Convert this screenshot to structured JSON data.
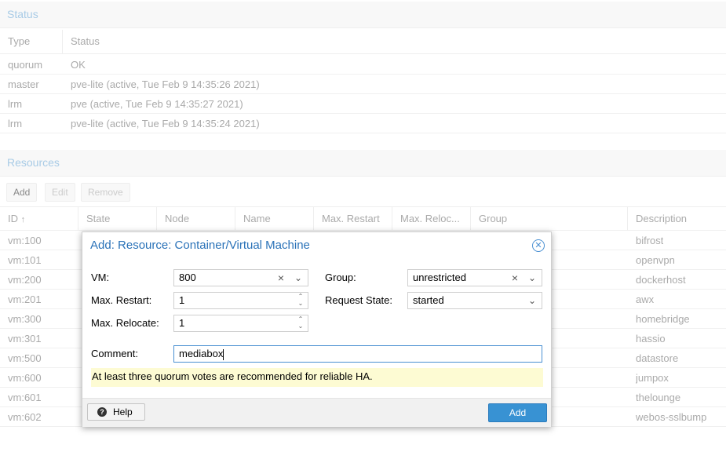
{
  "status": {
    "title": "Status",
    "columns": [
      "Type",
      "Status"
    ],
    "rows": [
      {
        "type": "quorum",
        "status": "OK"
      },
      {
        "type": "master",
        "status": "pve-lite (active, Tue Feb 9 14:35:26 2021)"
      },
      {
        "type": "lrm",
        "status": "pve (active, Tue Feb 9 14:35:27 2021)"
      },
      {
        "type": "lrm",
        "status": "pve-lite (active, Tue Feb 9 14:35:24 2021)"
      }
    ]
  },
  "resources": {
    "title": "Resources",
    "toolbar": {
      "add": "Add",
      "edit": "Edit",
      "remove": "Remove"
    },
    "columns": {
      "id": "ID",
      "state": "State",
      "node": "Node",
      "name": "Name",
      "max_restart": "Max. Restart",
      "max_relocate": "Max. Reloc...",
      "group": "Group",
      "description": "Description"
    },
    "sort_icon": "arrow-up",
    "rows": [
      {
        "id": "vm:100",
        "description": "bifrost"
      },
      {
        "id": "vm:101",
        "description": "openvpn"
      },
      {
        "id": "vm:200",
        "description": "dockerhost"
      },
      {
        "id": "vm:201",
        "description": "awx"
      },
      {
        "id": "vm:300",
        "description": "homebridge"
      },
      {
        "id": "vm:301",
        "description": "hassio"
      },
      {
        "id": "vm:500",
        "description": "datastore"
      },
      {
        "id": "vm:600",
        "description": "jumpox"
      },
      {
        "id": "vm:601",
        "description": "thelounge"
      },
      {
        "id": "vm:602",
        "description": "webos-sslbump"
      }
    ]
  },
  "dialog": {
    "title": "Add: Resource: Container/Virtual Machine",
    "close_icon": "circle-x",
    "vm_label": "VM:",
    "vm_value": "800",
    "max_restart_label": "Max. Restart:",
    "max_restart_value": "1",
    "max_relocate_label": "Max. Relocate:",
    "max_relocate_value": "1",
    "group_label": "Group:",
    "group_value": "unrestricted",
    "request_state_label": "Request State:",
    "request_state_value": "started",
    "comment_label": "Comment:",
    "comment_value": "mediabox",
    "warning": "At least three quorum votes are recommended for reliable HA.",
    "help_label": "Help",
    "add_label": "Add"
  },
  "colors": {
    "accent": "#3892d3",
    "title": "#2a72b8",
    "warning_bg": "#fdfbd3"
  }
}
